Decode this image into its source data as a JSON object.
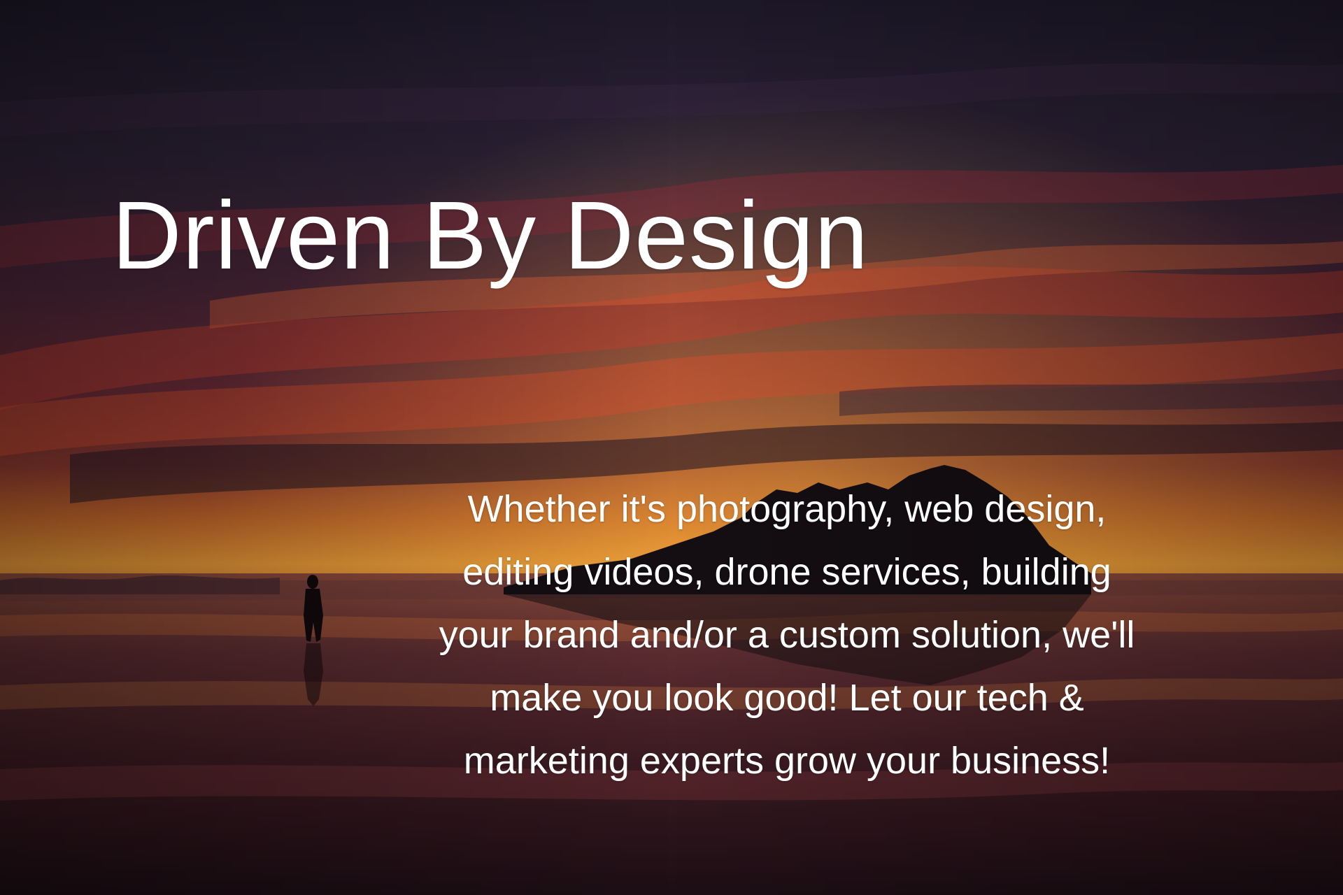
{
  "hero": {
    "headline": "Driven By Design",
    "tagline": "Whether it's photography, web design, editing videos, drone services, building your brand and/or a custom solution, we'll make you look good! Let our tech & marketing experts grow your business!"
  },
  "background": {
    "description_colors": {
      "sky_top": "#2a1f33",
      "sky_mid": "#5a2a3c",
      "cloud_red": "#d8452e",
      "horizon_orange": "#e8782a",
      "horizon_yellow": "#f0a030",
      "water": "#3a1c24",
      "silhouette": "#140e12"
    }
  }
}
